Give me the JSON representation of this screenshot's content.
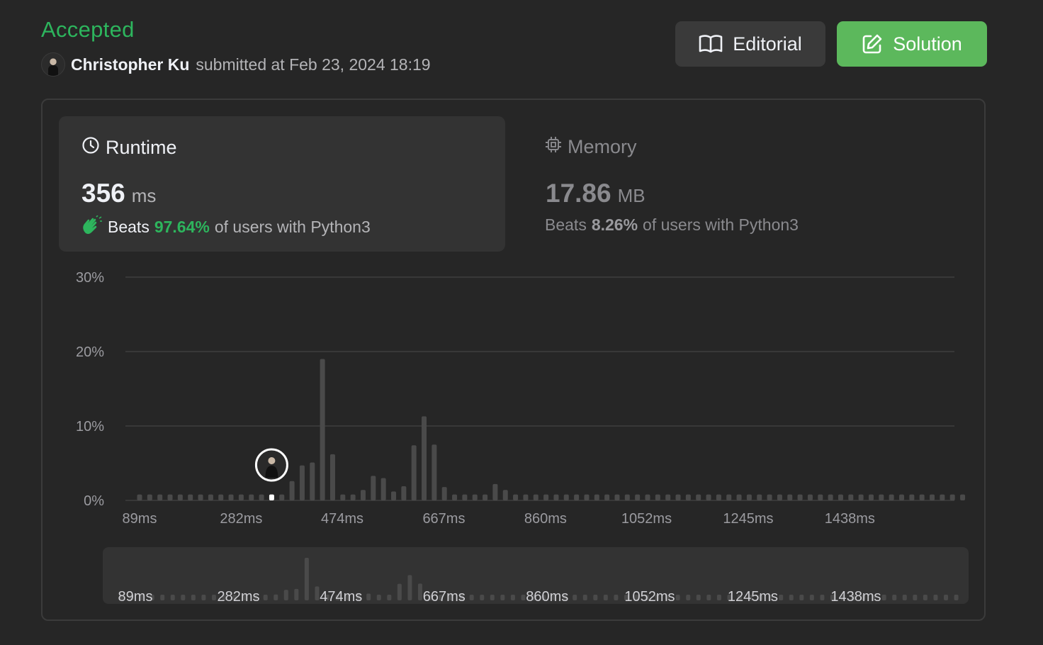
{
  "header": {
    "status": "Accepted",
    "user_name": "Christopher Ku",
    "submitted_text": "submitted at Feb 23, 2024 18:19"
  },
  "buttons": {
    "editorial_label": "Editorial",
    "solution_label": "Solution"
  },
  "runtime": {
    "title": "Runtime",
    "value": "356",
    "unit": "ms",
    "beats_label": "Beats",
    "beats_pct": "97.64%",
    "beats_suffix": "of users with Python3"
  },
  "memory": {
    "title": "Memory",
    "value": "17.86",
    "unit": "MB",
    "beats_label": "Beats",
    "beats_pct": "8.26%",
    "beats_suffix": "of users with Python3"
  },
  "colors": {
    "accepted": "#2db55d",
    "solution_button": "#5cb85c",
    "bar": "#4a4a4a",
    "marker_bar": "#ffffff"
  },
  "icons": {
    "editorial": "book-icon",
    "solution": "edit-icon",
    "runtime": "clock-icon",
    "memory": "cpu-icon",
    "beats": "clap-icon"
  },
  "chart_data": {
    "type": "bar",
    "xlabel": "",
    "ylabel": "",
    "ylim": [
      0,
      30
    ],
    "yticks": [
      "0%",
      "10%",
      "20%",
      "30%"
    ],
    "ytick_values": [
      0,
      10,
      20,
      30
    ],
    "xticks": [
      "89ms",
      "282ms",
      "474ms",
      "667ms",
      "860ms",
      "1052ms",
      "1245ms",
      "1438ms"
    ],
    "xtick_values": [
      89,
      282,
      474,
      667,
      860,
      1052,
      1245,
      1438
    ],
    "grid": true,
    "bin_width_ms": 19.3,
    "first_bin_ms": 89,
    "values": [
      0.8,
      0.8,
      0.8,
      0.8,
      0.8,
      0.8,
      0.8,
      0.8,
      0.8,
      0.8,
      0.8,
      0.8,
      0.8,
      0.8,
      0.8,
      2.6,
      4.7,
      5.1,
      19.0,
      6.2,
      0.8,
      0.8,
      1.4,
      3.3,
      3.0,
      1.2,
      1.9,
      7.4,
      11.3,
      7.5,
      1.8,
      0.8,
      0.8,
      0.8,
      0.8,
      2.2,
      1.4,
      0.8,
      0.8,
      0.8,
      0.8,
      0.8,
      0.8,
      0.8,
      0.8,
      0.8,
      0.8,
      0.8,
      0.8,
      0.8,
      0.8,
      0.8,
      0.8,
      0.8,
      0.8,
      0.8,
      0.8,
      0.8,
      0.8,
      0.8,
      0.8,
      0.8,
      0.8,
      0.8,
      0.8,
      0.8,
      0.8,
      0.8,
      0.8,
      0.8,
      0.8,
      0.8,
      0.8,
      0.8,
      0.8,
      0.8,
      0.8,
      0.8,
      0.8,
      0.8,
      0.8,
      0.8
    ],
    "user_bin_ms": 356,
    "user_bin_index": 13
  }
}
